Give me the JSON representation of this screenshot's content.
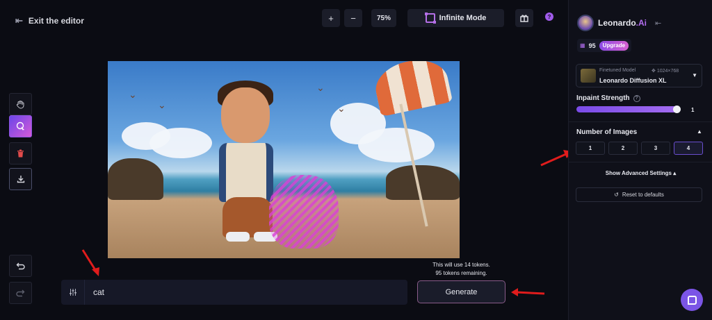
{
  "topbar": {
    "exit_label": "Exit the editor",
    "zoom_in": "+",
    "zoom_out": "−",
    "zoom_level": "75%",
    "infinite_mode": "Infinite Mode",
    "help": "?"
  },
  "prompt": {
    "value": "cat"
  },
  "generate": {
    "tokens_line1": "This will use 14 tokens.",
    "tokens_line2": "95 tokens remaining.",
    "label": "Generate"
  },
  "panel": {
    "brand": "Leonardo",
    "brand_suffix": ".Ai",
    "credits": "95",
    "upgrade": "Upgrade",
    "model": {
      "kind": "Finetuned Model",
      "resolution": "1024×768",
      "name": "Leonardo Diffusion XL"
    },
    "inpaint": {
      "label": "Inpaint Strength",
      "value": "1",
      "fraction": 1.0
    },
    "images": {
      "label": "Number of Images",
      "options": [
        "1",
        "2",
        "3",
        "4"
      ],
      "selected": "4"
    },
    "advanced": "Show Advanced Settings",
    "reset": "Reset to defaults"
  },
  "colors": {
    "accent": "#8b55e6",
    "annotation": "#e01c1c",
    "mask": "#da40d6"
  }
}
